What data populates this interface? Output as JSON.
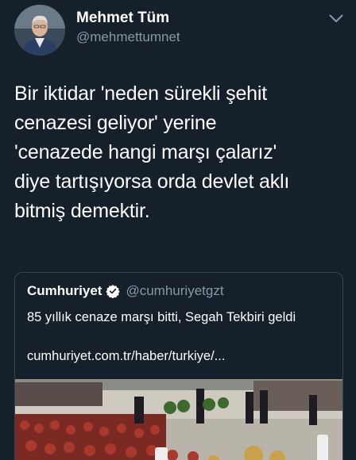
{
  "author": {
    "name": "Mehmet Tüm",
    "handle": "@mehmettumnet"
  },
  "tweet": {
    "text": "Bir iktidar 'neden sürekli şehit\ncenazesi geliyor' yerine\n'cenazede hangi marşı çalarız'\ndiye tartışıyorsa orda devlet aklı\nbitmiş demektir."
  },
  "quoted": {
    "name": "Cumhuriyet",
    "handle": "@cumhuriyetgzt",
    "text": "85 yıllık cenaze marşı bitti, Segah Tekbiri geldi",
    "link": "cumhuriyet.com.tr/haber/turkiye/..."
  },
  "icons": {
    "more": "chevron-down-icon",
    "verified": "verified-badge-icon"
  },
  "colors": {
    "background": "#15202b",
    "secondary_text": "#8899a6",
    "border": "#38444d",
    "verified": "#ffffff"
  }
}
